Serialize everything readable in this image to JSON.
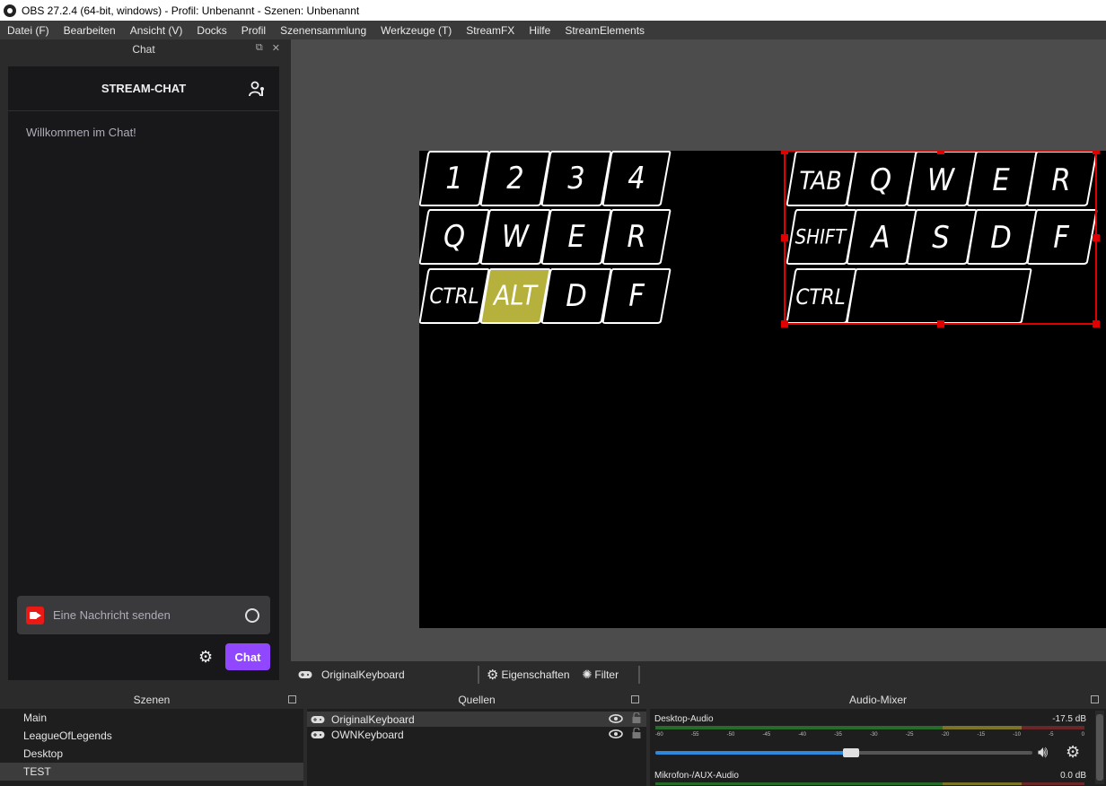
{
  "window": {
    "title": "OBS 27.2.4 (64-bit, windows) - Profil: Unbenannt - Szenen: Unbenannt"
  },
  "menu": [
    "Datei (F)",
    "Bearbeiten",
    "Ansicht (V)",
    "Docks",
    "Profil",
    "Szenensammlung",
    "Werkzeuge (T)",
    "StreamFX",
    "Hilfe",
    "StreamElements"
  ],
  "chat": {
    "dock_title": "Chat",
    "header": "STREAM-CHAT",
    "welcome": "Willkommen im Chat!",
    "input_placeholder": "Eine Nachricht senden",
    "send_label": "Chat",
    "accent": "#9147ff"
  },
  "canvas": {
    "left_keyboard": {
      "rows": [
        [
          "1",
          "2",
          "3",
          "4"
        ],
        [
          "Q",
          "W",
          "E",
          "R"
        ],
        [
          "CTRL",
          "ALT",
          "D",
          "F"
        ]
      ],
      "highlighted": "ALT",
      "highlight_color": "#b5b13c"
    },
    "right_keyboard": {
      "rows": [
        [
          "TAB",
          "Q",
          "W",
          "E",
          "R"
        ],
        [
          "SHIFT",
          "A",
          "S",
          "D",
          "F"
        ],
        [
          "CTRL",
          ""
        ]
      ],
      "selection_color": "#e00000"
    }
  },
  "source_toolbar": {
    "source_name": "OriginalKeyboard",
    "properties_label": "Eigenschaften",
    "filter_label": "Filter"
  },
  "scenes": {
    "title": "Szenen",
    "items": [
      "Main",
      "LeagueOfLegends",
      "Desktop",
      "TEST"
    ],
    "selected": "TEST"
  },
  "sources": {
    "title": "Quellen",
    "items": [
      "OriginalKeyboard",
      "OWNKeyboard"
    ],
    "selected": "OriginalKeyboard"
  },
  "mixer": {
    "title": "Audio-Mixer",
    "channels": [
      {
        "name": "Desktop-Audio",
        "db": "-17.5 dB",
        "volume": 0.52
      },
      {
        "name": "Mikrofon-/AUX-Audio",
        "db": "0.0 dB"
      }
    ],
    "ticks": [
      "-60",
      "-55",
      "-50",
      "-45",
      "-40",
      "-35",
      "-30",
      "-25",
      "-20",
      "-15",
      "-10",
      "-5",
      "0"
    ]
  }
}
